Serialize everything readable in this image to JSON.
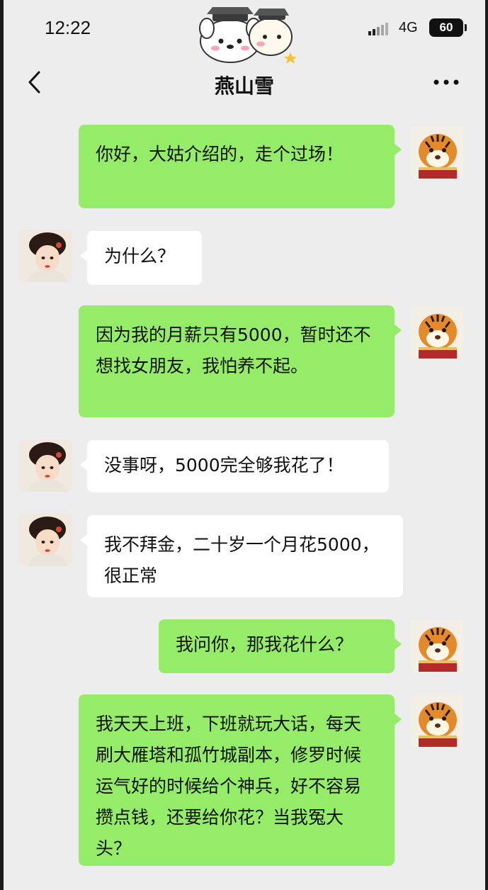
{
  "status_bar": {
    "time": "12:22",
    "network": "4G",
    "battery": "60"
  },
  "nav": {
    "title": "燕山雪",
    "back_icon": "chevron-left-icon",
    "more_icon": "more-dots-icon"
  },
  "colors": {
    "background": "#ededed",
    "outgoing_bubble": "#95ec69",
    "incoming_bubble": "#ffffff"
  },
  "messages": [
    {
      "sender": "me",
      "text": "你好，大姑介绍的，走个过场！"
    },
    {
      "sender": "her",
      "text": "为什么？"
    },
    {
      "sender": "me",
      "text": "因为我的月薪只有5000，暂时还不想找女朋友，我怕养不起。"
    },
    {
      "sender": "her",
      "text": "没事呀，5000完全够我花了！"
    },
    {
      "sender": "her",
      "text": "我不拜金，二十岁一个月花5000，很正常"
    },
    {
      "sender": "me",
      "text": "我问你，那我花什么？"
    },
    {
      "sender": "me",
      "text": "我天天上班，下班就玩大话，每天刷大雁塔和孤竹城副本，修罗时候运气好的时候给个神兵，好不容易攒点钱，还要给你花？当我冤大头？"
    }
  ]
}
